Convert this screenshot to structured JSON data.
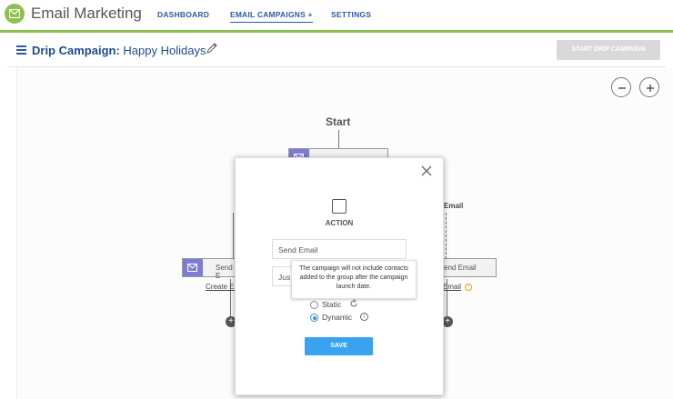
{
  "app": {
    "title": "Email Marketing",
    "brand_color": "#8cc152",
    "logo_icon": "envelope-icon"
  },
  "nav": {
    "items": [
      {
        "label": "DASHBOARD"
      },
      {
        "label": "EMAIL CAMPAIGNS +"
      },
      {
        "label": "SETTINGS"
      }
    ],
    "active_index": 1
  },
  "campaign": {
    "prefix": "Drip Campaign:",
    "name": "Happy Holidays",
    "start_button": "START DRIP CAMPAIGN"
  },
  "canvas": {
    "start_label": "Start",
    "left_node": {
      "text": "Send E",
      "link": "Create Em"
    },
    "right_node": {
      "text": "end Email",
      "side_label": "Email",
      "link": "Email"
    },
    "plus": "+"
  },
  "modal": {
    "action_label": "ACTION",
    "action_value": "Send Email",
    "second_field_value": "Jus",
    "tooltip": "The campaign will not include contacts added to the group after the campaign launch date.",
    "radios": [
      {
        "label": "Static",
        "checked": false
      },
      {
        "label": "Dynamic",
        "checked": true
      }
    ],
    "save_label": "SAVE"
  }
}
